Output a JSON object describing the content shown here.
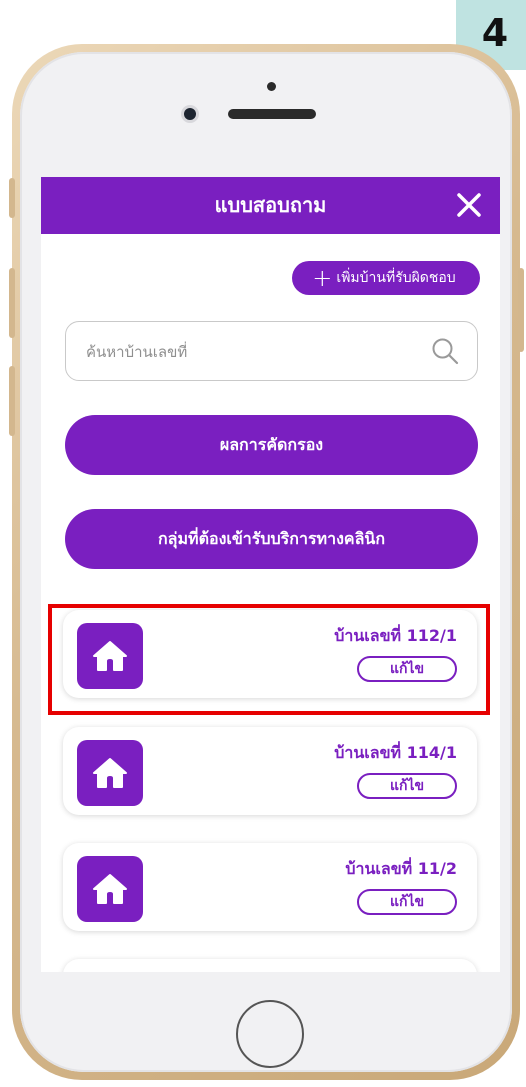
{
  "step_badge": "4",
  "header": {
    "title": "แบบสอบถาม",
    "close_icon": "close-icon"
  },
  "add_house": {
    "plus": "+",
    "label": "เพิ่มบ้านที่รับผิดชอบ"
  },
  "search": {
    "placeholder": "ค้นหาบ้านเลขที่",
    "value": "",
    "icon": "search-icon"
  },
  "buttons": {
    "screening_results": "ผลการคัดกรอง",
    "clinic_group": "กลุ่มที่ต้องเข้ารับบริการทางคลินิก"
  },
  "houses": [
    {
      "label": "บ้านเลขที่ 112/1",
      "edit": "แก้ไข",
      "icon": "house-icon"
    },
    {
      "label": "บ้านเลขที่ 114/1",
      "edit": "แก้ไข",
      "icon": "house-icon"
    },
    {
      "label": "บ้านเลขที่ 11/2",
      "edit": "แก้ไข",
      "icon": "house-icon"
    }
  ],
  "colors": {
    "accent": "#7a1fc0",
    "highlight": "#e60000",
    "badge": "#bfe3e1"
  }
}
